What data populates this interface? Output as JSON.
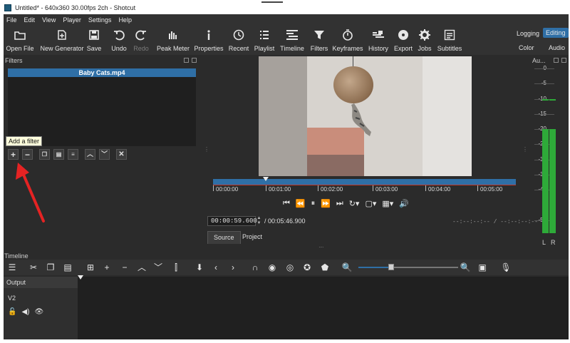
{
  "window": {
    "title": "Untitled* - 640x360 30.00fps 2ch - Shotcut"
  },
  "menu": [
    "File",
    "Edit",
    "View",
    "Player",
    "Settings",
    "Help"
  ],
  "toolbar": {
    "items": [
      {
        "label": "Open File",
        "icon": "folder-icon"
      },
      {
        "label": "New Generator",
        "icon": "generator-icon"
      },
      {
        "label": "Save",
        "icon": "save-icon"
      },
      {
        "label": "Undo",
        "icon": "undo-icon"
      },
      {
        "label": "Redo",
        "icon": "redo-icon",
        "disabled": true
      },
      {
        "label": "Peak Meter",
        "icon": "peak-meter-icon"
      },
      {
        "label": "Properties",
        "icon": "info-icon"
      },
      {
        "label": "Recent",
        "icon": "clock-icon"
      },
      {
        "label": "Playlist",
        "icon": "list-icon"
      },
      {
        "label": "Timeline",
        "icon": "timeline-icon"
      },
      {
        "label": "Filters",
        "icon": "funnel-icon"
      },
      {
        "label": "Keyframes",
        "icon": "stopwatch-icon"
      },
      {
        "label": "History",
        "icon": "history-icon"
      },
      {
        "label": "Export",
        "icon": "disc-icon"
      },
      {
        "label": "Jobs",
        "icon": "gear-icon"
      },
      {
        "label": "Subtitles",
        "icon": "subtitles-icon"
      }
    ],
    "layouts": {
      "logging": "Logging",
      "editing": "Editing",
      "color": "Color",
      "audio": "Audio"
    }
  },
  "filters_panel": {
    "title": "Filters",
    "clip_name": "Baby Cats.mp4",
    "tooltip": "Add a filter"
  },
  "player": {
    "ruler_labels": [
      "00:00:00",
      "00:01:00",
      "00:02:00",
      "00:03:00",
      "00:04:00",
      "00:05:00"
    ],
    "current_time": "00:00:59.600",
    "duration_text": "/ 00:05:46.900",
    "in_out": "--:--:--:--  /  --:--:--:--",
    "tabs": {
      "source": "Source",
      "project": "Project"
    }
  },
  "audio_meter": {
    "title": "Au...",
    "scale": [
      "0",
      "-5",
      "-10",
      "-15",
      "-20",
      "-25",
      "-30",
      "-35",
      "-40",
      "-50"
    ],
    "channels": [
      "L",
      "R"
    ],
    "level_db": [
      -20,
      -20
    ],
    "peak_db": [
      -10,
      -10
    ],
    "color": "#2eaa39"
  },
  "timeline": {
    "title": "Timeline",
    "output_label": "Output",
    "tracks": [
      {
        "name": "V2"
      }
    ]
  },
  "colors": {
    "accent": "#2f6fa6",
    "background": "#2b2b2b",
    "toolbar": "#323232"
  }
}
